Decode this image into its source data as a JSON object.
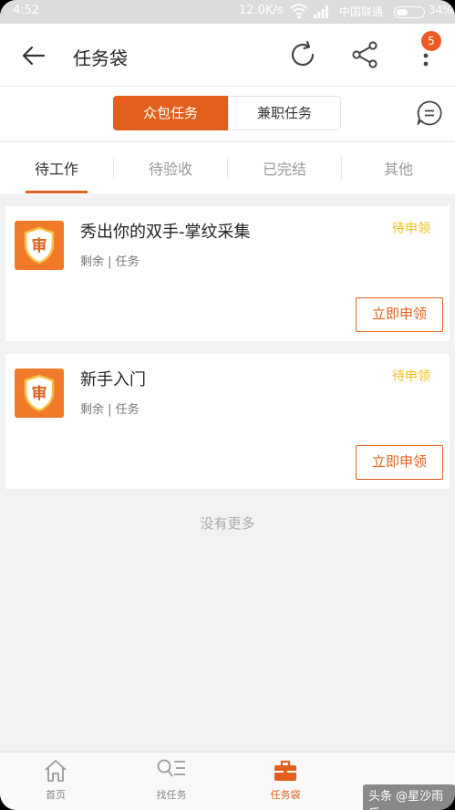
{
  "status_bar": {
    "time": "4:52",
    "speed": "12.0K/s",
    "carrier": "中国联通",
    "battery": "34%"
  },
  "header": {
    "title": "任务袋",
    "badge_count": "5"
  },
  "segments": {
    "crowd_label": "众包任务",
    "parttime_label": "兼职任务"
  },
  "tabs": [
    {
      "label": "待工作"
    },
    {
      "label": "待验收"
    },
    {
      "label": "已完结"
    },
    {
      "label": "其他"
    }
  ],
  "tasks": [
    {
      "title": "秀出你的双手-掌纹采集",
      "status": "待申领",
      "meta": "剩余 | 任务",
      "button": "立即申领",
      "logo_char": "审"
    },
    {
      "title": "新手入门",
      "status": "待申领",
      "meta": "剩余 | 任务",
      "button": "立即申领",
      "logo_char": "审"
    }
  ],
  "footer_note": "没有更多",
  "bottom_nav": [
    {
      "label": "首页",
      "icon": "home-icon"
    },
    {
      "label": "找任务",
      "icon": "search-list-icon"
    },
    {
      "label": "任务袋",
      "icon": "briefcase-icon"
    }
  ],
  "watermark": "头条 @星沙雨乐",
  "colors": {
    "accent": "#e2601b",
    "status_yellow": "#f2bf1a",
    "logo_orange": "#f07a2a"
  }
}
